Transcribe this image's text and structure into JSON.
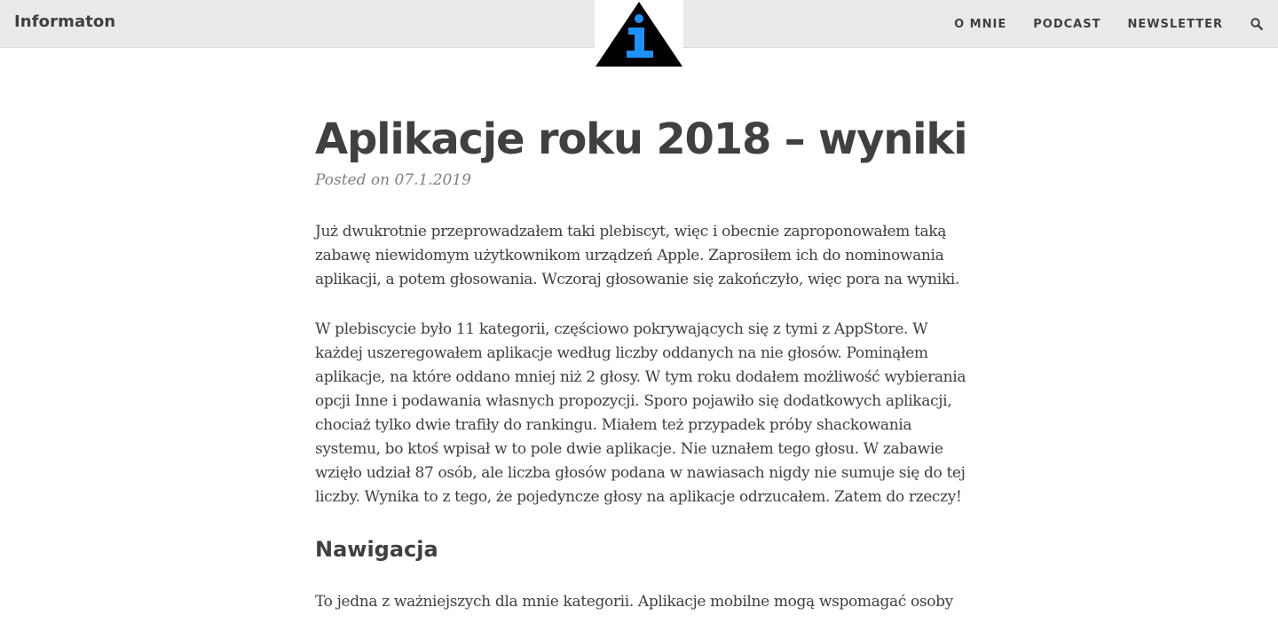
{
  "header": {
    "brand": "Informaton",
    "nav": [
      {
        "label": "O MNIE"
      },
      {
        "label": "PODCAST"
      },
      {
        "label": "NEWSLETTER"
      }
    ],
    "search_icon": "search-icon"
  },
  "logo": {
    "icon": "info-triangle-icon",
    "colors": {
      "triangle": "#000000",
      "glyph": "#1e90ff"
    }
  },
  "post": {
    "title": "Aplikacje roku 2018 – wyniki",
    "meta": "Posted on 07.1.2019",
    "paragraphs": [
      "Już dwukrotnie przeprowadzałem taki plebiscyt, więc i obecnie zaproponowałem taką zabawę niewidomym użytkownikom urządzeń Apple. Zaprosiłem ich do nominowania aplikacji, a potem głosowania. Wczoraj głosowanie się zakończyło, więc pora na wyniki.",
      "W plebiscycie było 11 kategorii, częściowo pokrywających się z tymi z AppStore. W każdej uszeregowałem aplikacje według liczby oddanych na nie głosów. Pominąłem aplikacje, na które oddano mniej niż 2 głosy. W tym roku dodałem możliwość wybierania opcji Inne i podawania własnych propozycji. Sporo pojawiło się dodatkowych aplikacji, chociaż tylko dwie trafiły do rankingu. Miałem też przypadek próby shackowania systemu, bo ktoś wpisał w to pole dwie aplikacje. Nie uznałem tego głosu. W zabawie wzięło udział 87 osób, ale liczba głosów podana w nawiasach nigdy nie sumuje się do tej liczby. Wynika to z tego, że pojedyncze głosy na aplikacje odrzucałem. Zatem do rzeczy!"
    ],
    "section_heading": "Nawigacja",
    "section_paragraph": "To jedna z ważniejszych dla mnie kategorii. Aplikacje mobilne mogą wspomagać osoby"
  },
  "colors": {
    "header_bg": "#eaeaea",
    "text": "#404040",
    "meta": "#808080"
  }
}
